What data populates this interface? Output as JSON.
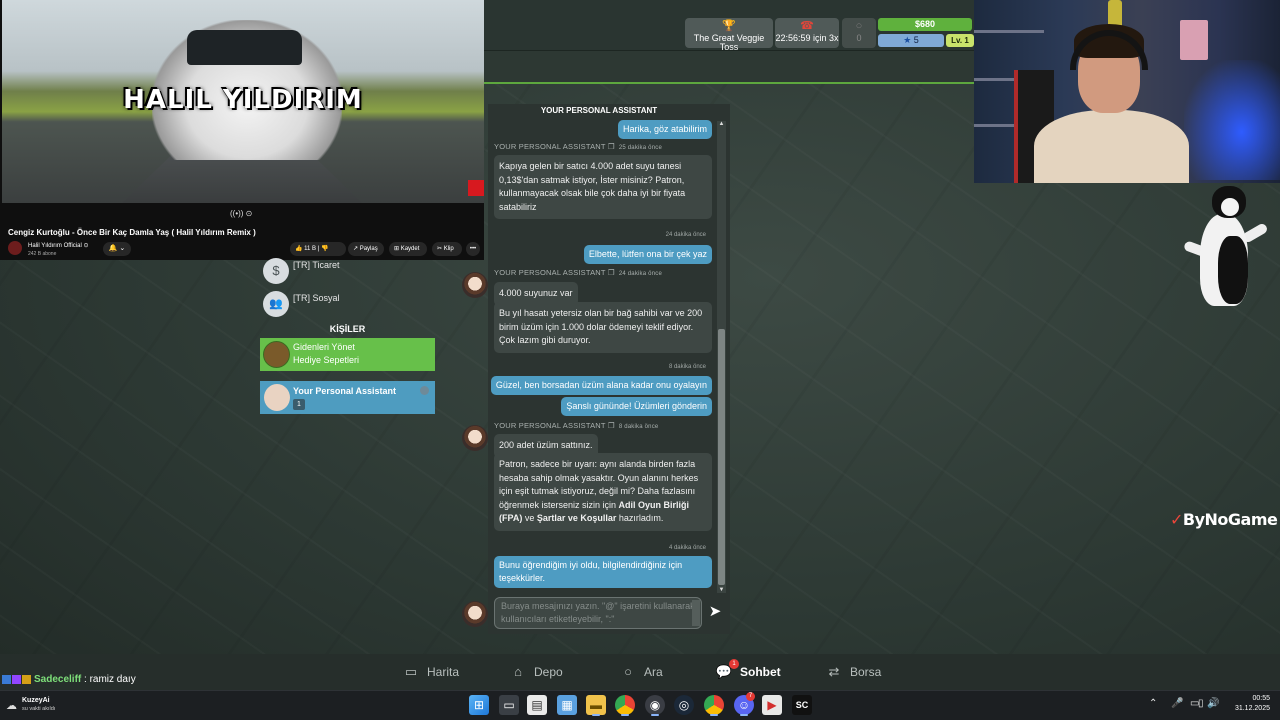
{
  "video": {
    "overlay_title": "HALIL YILDIRIM",
    "controls": "((•)) ⊙",
    "name": "Cengiz Kurtoğlu - Önce Bir Kaç Damla Yaş ( Halil Yıldırım Remix )",
    "channel": "Halil Yıldırım Official ⊙",
    "subscribers": "242 B abone",
    "like_count": "11 B",
    "share_label": "Paylaş",
    "save_label": "Kaydet",
    "clip_label": "Klip",
    "more_label": "•••"
  },
  "hud": {
    "event_label": "The Great Veggie Toss",
    "timer_label": "22:56:59 için 3x",
    "empty_value": "0",
    "money": "$680",
    "stars": "5",
    "level": "Lv. 1"
  },
  "left_panel": {
    "categories": [
      {
        "label": "[TR] Ticaret",
        "icon": "$"
      },
      {
        "label": "[TR] Sosyal",
        "icon": "👥"
      }
    ],
    "section_title": "KİŞİLER",
    "contacts": [
      {
        "line1": "Gidenleri Yönet",
        "line2": "Hediye Sepetleri"
      },
      {
        "name": "Your Personal Assistant",
        "badge": "1"
      }
    ]
  },
  "chat": {
    "title": "YOUR PERSONAL ASSISTANT",
    "messages": [
      {
        "type": "out",
        "text": "Harika, göz atabilirim"
      },
      {
        "type": "sender",
        "name": "YOUR PERSONAL ASSISTANT",
        "time": "25 dakika önce"
      },
      {
        "type": "in",
        "text": "Kapıya gelen bir satıcı 4.000 adet suyu tanesi 0,13$'dan satmak istiyor, İster misiniz? Patron, kullanmayacak olsak bile çok daha iyi bir fiyata satabiliriz"
      },
      {
        "type": "stamp",
        "text": "24 dakika önce"
      },
      {
        "type": "out",
        "text": "Elbette, lütfen ona bir çek yaz"
      },
      {
        "type": "sender",
        "name": "YOUR PERSONAL ASSISTANT",
        "time": "24 dakika önce"
      },
      {
        "type": "in",
        "text": "4.000 suyunuz var"
      },
      {
        "type": "in",
        "text": "Bu yıl hasatı yetersiz olan bir bağ sahibi var ve 200 birim üzüm için 1.000 dolar ödemeyi teklif ediyor. Çok lazım gibi duruyor."
      },
      {
        "type": "stamp",
        "text": "8 dakika önce"
      },
      {
        "type": "out",
        "text": "Güzel, ben borsadan üzüm alana kadar onu oyalayın"
      },
      {
        "type": "out",
        "text": "Şanslı gününde! Üzümleri gönderin"
      },
      {
        "type": "sender",
        "name": "YOUR PERSONAL ASSISTANT",
        "time": "8 dakika önce"
      },
      {
        "type": "in",
        "text": "200 adet üzüm sattınız."
      },
      {
        "type": "in",
        "text_pre": "Patron, sadece bir uyarı: aynı alanda birden fazla hesaba sahip olmak yasaktır. Oyun alanını herkes için eşit tutmak istiyoruz, değil mi? Daha fazlasını öğrenmek isterseniz sizin için ",
        "bold1": "Adil Oyun Birliği (FPA)",
        "mid": " ve ",
        "bold2": "Şartlar ve Koşullar",
        "post": " hazırladım."
      },
      {
        "type": "stamp",
        "text": "4 dakika önce"
      },
      {
        "type": "out",
        "text": "Bunu öğrendiğim iyi oldu, bilgilendirdiğiniz için teşekkürler."
      }
    ],
    "input_placeholder": "Buraya mesajınızı yazın. \"@\" işaretini kullanarak kullanıcıları etiketleyebilir, \":\"",
    "send_icon": "➤"
  },
  "watermark": {
    "mark": "✓",
    "text": "ByNoGame"
  },
  "nav": {
    "items": [
      {
        "label": "Harita",
        "icon": "▭"
      },
      {
        "label": "Depo",
        "icon": "⌂"
      },
      {
        "label": "Ara",
        "icon": "○"
      },
      {
        "label": "Sohbet",
        "icon": "💬"
      },
      {
        "label": "Borsa",
        "icon": "⇄"
      }
    ],
    "sohbet_badge": "1"
  },
  "stream_chat": {
    "user": "Sadeceliff",
    "message": " : ramiz daıy"
  },
  "taskbar": {
    "weather_title": "KuzeyAi",
    "weather_sub": "su vakti akıldı",
    "time": "00:55",
    "date": "31.12.2025",
    "discord_badge": "7",
    "sc_label": "SC"
  },
  "colors": {
    "accent_green": "#67c04a",
    "accent_blue": "#4e9cc0",
    "money_green": "#5fb13d",
    "chat_bg": "#2c3431"
  }
}
